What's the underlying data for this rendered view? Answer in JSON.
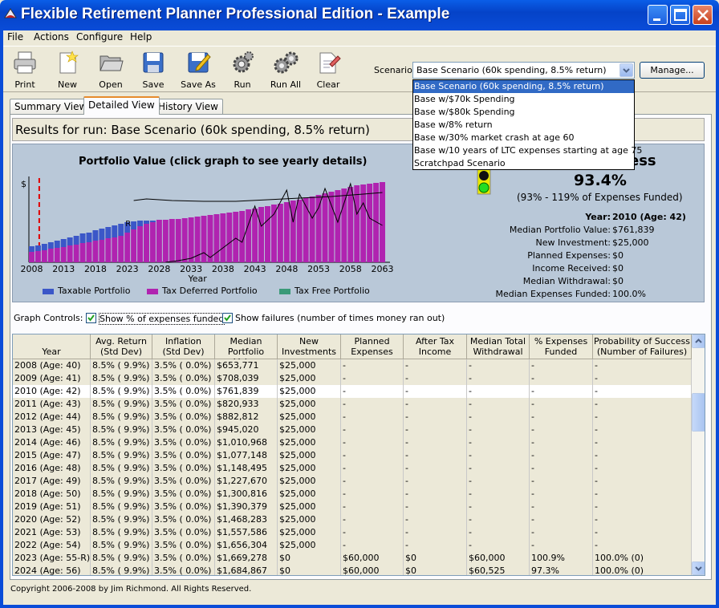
{
  "window": {
    "title": "Flexible Retirement Planner Professional Edition - Example"
  },
  "menu": [
    "File",
    "Actions",
    "Configure",
    "Help"
  ],
  "toolbar": {
    "buttons": [
      {
        "label": "Print",
        "icon": "printer-icon"
      },
      {
        "label": "New",
        "icon": "new-document-icon"
      },
      {
        "label": "Open",
        "icon": "folder-open-icon"
      },
      {
        "label": "Save",
        "icon": "floppy-disk-icon"
      },
      {
        "label": "Save As",
        "icon": "save-as-icon"
      },
      {
        "label": "Run",
        "icon": "gear-icon"
      },
      {
        "label": "Run All",
        "icon": "gears-icon"
      },
      {
        "label": "Clear",
        "icon": "eraser-icon"
      }
    ]
  },
  "scenario": {
    "label": "Scenario:",
    "selected": "Base Scenario (60k spending, 8.5% return)",
    "manage_label": "Manage...",
    "options": [
      "Base Scenario (60k spending, 8.5% return)",
      "Base w/$70k Spending",
      "Base w/$80k Spending",
      "Base w/8% return",
      "Base w/30% market crash at age 60",
      "Base w/10 years of LTC expenses starting at age 75",
      "Scratchpad Scenario"
    ]
  },
  "tabs": [
    "Summary View",
    "Detailed View",
    "History View"
  ],
  "results_title": "Results for run:  Base Scenario (60k spending, 8.5% return)",
  "graph": {
    "title": "Portfolio Value  (click graph to see yearly details)",
    "y_axis_label": "$",
    "marker_label": "R",
    "x_axis_label": "Year",
    "x_ticks": [
      "2008",
      "2013",
      "2018",
      "2023",
      "2028",
      "2033",
      "2038",
      "2043",
      "2048",
      "2053",
      "2058",
      "2063"
    ],
    "legend": [
      {
        "label": "Taxable Portfolio",
        "color": "#3b57c8"
      },
      {
        "label": "Tax Deferred Portfolio",
        "color": "#b023b0"
      },
      {
        "label": "Tax Free Portfolio",
        "color": "#3a9a78"
      }
    ]
  },
  "chart_data": {
    "type": "bar",
    "x": [
      2008,
      2009,
      2010,
      2011,
      2012,
      2013,
      2014,
      2015,
      2016,
      2017,
      2018,
      2019,
      2020,
      2021,
      2022,
      2023,
      2024,
      2025,
      2026,
      2027,
      2028,
      2029,
      2030,
      2031,
      2032,
      2033,
      2034,
      2035,
      2036,
      2037,
      2038,
      2039,
      2040,
      2041,
      2042,
      2043,
      2044,
      2045,
      2046,
      2047,
      2048,
      2049,
      2050,
      2051,
      2052,
      2053,
      2054,
      2055,
      2056,
      2057,
      2058,
      2059,
      2060,
      2061,
      2062,
      2063
    ],
    "series": [
      {
        "name": "Taxable Portfolio",
        "values": [
          0.07,
          0.07,
          0.08,
          0.08,
          0.09,
          0.1,
          0.1,
          0.11,
          0.12,
          0.12,
          0.13,
          0.14,
          0.14,
          0.15,
          0.15,
          0.13,
          0.1,
          0.07,
          0.04,
          0.02,
          0.0,
          0,
          0,
          0,
          0,
          0,
          0,
          0,
          0,
          0,
          0,
          0,
          0,
          0,
          0,
          0,
          0,
          0,
          0,
          0,
          0,
          0,
          0,
          0,
          0,
          0,
          0,
          0,
          0,
          0,
          0,
          0,
          0,
          0,
          0,
          0
        ]
      },
      {
        "name": "Tax Deferred Portfolio",
        "values": [
          0.13,
          0.14,
          0.15,
          0.17,
          0.18,
          0.19,
          0.21,
          0.22,
          0.24,
          0.25,
          0.27,
          0.28,
          0.3,
          0.31,
          0.33,
          0.37,
          0.41,
          0.45,
          0.48,
          0.5,
          0.53,
          0.53,
          0.54,
          0.54,
          0.55,
          0.56,
          0.57,
          0.58,
          0.59,
          0.6,
          0.61,
          0.62,
          0.63,
          0.64,
          0.66,
          0.67,
          0.69,
          0.7,
          0.72,
          0.73,
          0.75,
          0.77,
          0.78,
          0.8,
          0.82,
          0.84,
          0.86,
          0.88,
          0.9,
          0.92,
          0.94,
          0.96,
          0.97,
          0.98,
          0.99,
          1.0
        ]
      },
      {
        "name": "Tax Free Portfolio",
        "values": [
          0,
          0,
          0,
          0,
          0,
          0,
          0,
          0,
          0,
          0,
          0,
          0,
          0,
          0,
          0,
          0,
          0,
          0,
          0,
          0,
          0,
          0,
          0,
          0,
          0,
          0,
          0,
          0,
          0,
          0,
          0,
          0,
          0,
          0,
          0,
          0,
          0,
          0,
          0,
          0,
          0,
          0,
          0,
          0,
          0,
          0,
          0,
          0,
          0,
          0,
          0,
          0,
          0,
          0,
          0,
          0
        ]
      }
    ],
    "xlabel": "Year",
    "ylabel": "$",
    "note_marker": "R",
    "line_top": {
      "x": [
        2024,
        2026,
        2030,
        2035,
        2040,
        2045,
        2050,
        2055,
        2060,
        2063
      ],
      "values": [
        0.77,
        0.79,
        0.77,
        0.76,
        0.76,
        0.78,
        0.8,
        0.82,
        0.85,
        0.87
      ]
    },
    "line_jagged": {
      "x": [
        2029,
        2031,
        2033,
        2035,
        2036,
        2038,
        2040,
        2041,
        2043,
        2044,
        2046,
        2048,
        2049,
        2050,
        2052,
        2053,
        2054,
        2056,
        2058,
        2059,
        2060,
        2061,
        2063
      ],
      "values": [
        0.0,
        0.02,
        0.05,
        0.12,
        0.06,
        0.18,
        0.3,
        0.25,
        0.7,
        0.45,
        0.6,
        0.9,
        0.5,
        0.85,
        0.55,
        0.68,
        0.92,
        0.5,
        0.98,
        0.6,
        0.74,
        0.55,
        0.46
      ]
    }
  },
  "success": {
    "title": "ess",
    "percent": "93.4%",
    "funded_range": "(93% - 119% of Expenses Funded)",
    "stats": [
      {
        "label": "Year:",
        "value": "2010 (Age: 42)",
        "bold": true
      },
      {
        "label": "Median Portfolio Value:",
        "value": "$761,839"
      },
      {
        "label": "New Investment:",
        "value": "$25,000"
      },
      {
        "label": "Planned Expenses:",
        "value": "$0"
      },
      {
        "label": "Income Received:",
        "value": "$0"
      },
      {
        "label": "Median Withdrawal:",
        "value": "$0"
      },
      {
        "label": "Median Expenses Funded:",
        "value": "100.0%"
      }
    ]
  },
  "graph_controls": {
    "label": "Graph Controls:",
    "show_pct": "Show % of expenses funded",
    "show_failures": "Show failures (number of times money ran out)"
  },
  "table": {
    "columns": [
      "Year",
      "Avg. Return\n(Std Dev)",
      "Inflation\n(Std Dev)",
      "Median\nPortfolio Value",
      "New\nInvestments",
      "Planned\nExpenses",
      "After Tax\nIncome",
      "Median Total\nWithdrawal",
      "% Expenses\nFunded",
      "Probability of Success\n(Number of Failures)"
    ],
    "rows": [
      [
        "2008 (Age: 40)",
        "8.5% ( 9.9%)",
        "3.5% ( 0.0%)",
        "$653,771",
        "$25,000",
        "-",
        "-",
        "-",
        "-",
        "-"
      ],
      [
        "2009 (Age: 41)",
        "8.5% ( 9.9%)",
        "3.5% ( 0.0%)",
        "$708,039",
        "$25,000",
        "-",
        "-",
        "-",
        "-",
        "-"
      ],
      [
        "2010 (Age: 42)",
        "8.5% ( 9.9%)",
        "3.5% ( 0.0%)",
        "$761,839",
        "$25,000",
        "-",
        "-",
        "-",
        "-",
        "-"
      ],
      [
        "2011 (Age: 43)",
        "8.5% ( 9.9%)",
        "3.5% ( 0.0%)",
        "$820,933",
        "$25,000",
        "-",
        "-",
        "-",
        "-",
        "-"
      ],
      [
        "2012 (Age: 44)",
        "8.5% ( 9.9%)",
        "3.5% ( 0.0%)",
        "$882,812",
        "$25,000",
        "-",
        "-",
        "-",
        "-",
        "-"
      ],
      [
        "2013 (Age: 45)",
        "8.5% ( 9.9%)",
        "3.5% ( 0.0%)",
        "$945,020",
        "$25,000",
        "-",
        "-",
        "-",
        "-",
        "-"
      ],
      [
        "2014 (Age: 46)",
        "8.5% ( 9.9%)",
        "3.5% ( 0.0%)",
        "$1,010,968",
        "$25,000",
        "-",
        "-",
        "-",
        "-",
        "-"
      ],
      [
        "2015 (Age: 47)",
        "8.5% ( 9.9%)",
        "3.5% ( 0.0%)",
        "$1,077,148",
        "$25,000",
        "-",
        "-",
        "-",
        "-",
        "-"
      ],
      [
        "2016 (Age: 48)",
        "8.5% ( 9.9%)",
        "3.5% ( 0.0%)",
        "$1,148,495",
        "$25,000",
        "-",
        "-",
        "-",
        "-",
        "-"
      ],
      [
        "2017 (Age: 49)",
        "8.5% ( 9.9%)",
        "3.5% ( 0.0%)",
        "$1,227,670",
        "$25,000",
        "-",
        "-",
        "-",
        "-",
        "-"
      ],
      [
        "2018 (Age: 50)",
        "8.5% ( 9.9%)",
        "3.5% ( 0.0%)",
        "$1,300,816",
        "$25,000",
        "-",
        "-",
        "-",
        "-",
        "-"
      ],
      [
        "2019 (Age: 51)",
        "8.5% ( 9.9%)",
        "3.5% ( 0.0%)",
        "$1,390,379",
        "$25,000",
        "-",
        "-",
        "-",
        "-",
        "-"
      ],
      [
        "2020 (Age: 52)",
        "8.5% ( 9.9%)",
        "3.5% ( 0.0%)",
        "$1,468,283",
        "$25,000",
        "-",
        "-",
        "-",
        "-",
        "-"
      ],
      [
        "2021 (Age: 53)",
        "8.5% ( 9.9%)",
        "3.5% ( 0.0%)",
        "$1,557,586",
        "$25,000",
        "-",
        "-",
        "-",
        "-",
        "-"
      ],
      [
        "2022 (Age: 54)",
        "8.5% ( 9.9%)",
        "3.5% ( 0.0%)",
        "$1,656,304",
        "$25,000",
        "-",
        "-",
        "-",
        "-",
        "-"
      ],
      [
        "2023 (Age: 55-R)",
        "8.5% ( 9.9%)",
        "3.5% ( 0.0%)",
        "$1,669,278",
        "$0",
        "$60,000",
        "$0",
        "$60,000",
        "100.9%",
        "100.0% (0)"
      ],
      [
        "2024 (Age: 56)",
        "8.5% ( 9.9%)",
        "3.5% ( 0.0%)",
        "$1,684,867",
        "$0",
        "$60,000",
        "$0",
        "$60,525",
        "97.3%",
        "100.0% (0)"
      ]
    ],
    "selected_row": 2
  },
  "copyright": "Copyright 2006-2008 by Jim Richmond.  All Rights Reserved."
}
